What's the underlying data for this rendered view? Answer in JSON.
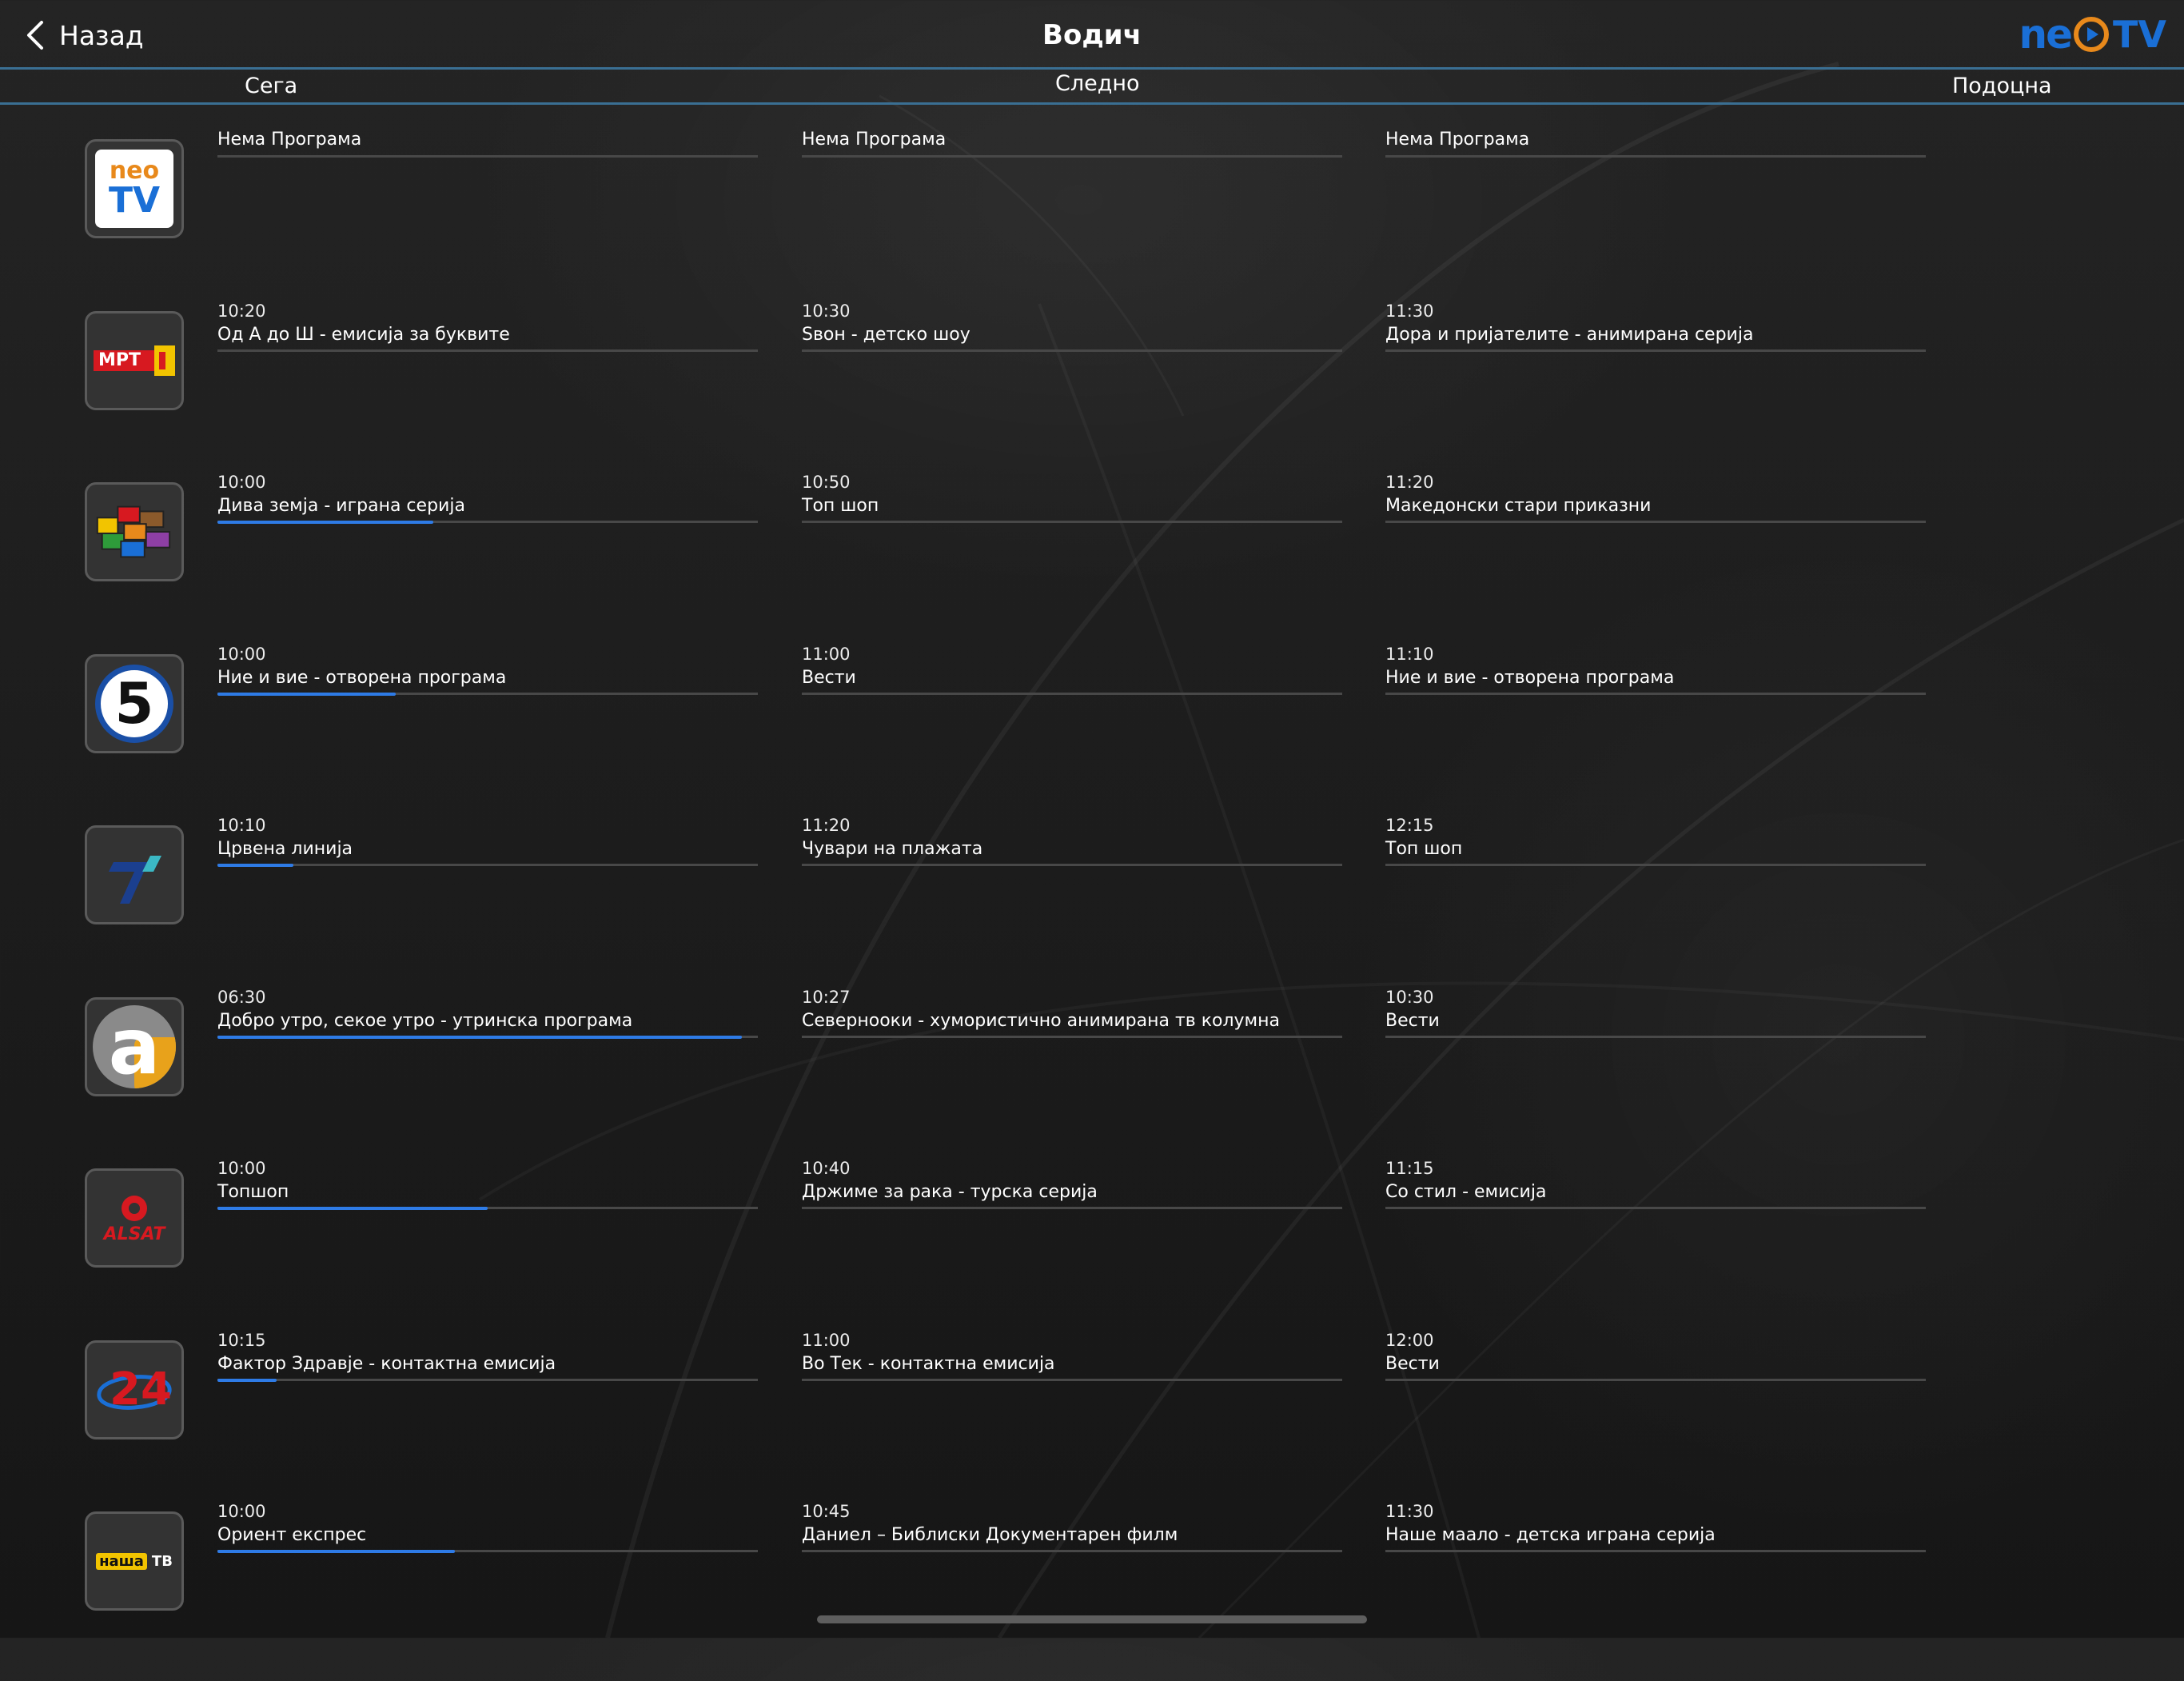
{
  "header": {
    "back_label": "Назад",
    "title": "Водич",
    "logo_neo": "ne",
    "logo_tv": "TV"
  },
  "columns": {
    "now": "Сега",
    "next": "Следно",
    "later": "Подоцна"
  },
  "channels": [
    {
      "logo": "neo-tv-logo",
      "logo_text_top": "neo",
      "logo_text_bottom": "TV",
      "now": {
        "time": "",
        "title": "Нема Програма",
        "progress": 0
      },
      "next": {
        "time": "",
        "title": "Нема Програма"
      },
      "later": {
        "time": "",
        "title": "Нема Програма"
      }
    },
    {
      "logo": "mrt1-logo",
      "logo_text": "МРТ",
      "now": {
        "time": "10:20",
        "title": "Од А до Ш - емисија за буквите",
        "progress": 0
      },
      "next": {
        "time": "10:30",
        "title": "Ѕвон - детско шоу"
      },
      "later": {
        "time": "11:30",
        "title": "Дора и пријателите - анимирана серија"
      }
    },
    {
      "logo": "colored-blocks-logo",
      "now": {
        "time": "10:00",
        "title": "Дива земја - играна серија",
        "progress": 0.4
      },
      "next": {
        "time": "10:50",
        "title": "Топ шоп"
      },
      "later": {
        "time": "11:20",
        "title": "Македонски стари приказни"
      }
    },
    {
      "logo": "kanal5-logo",
      "logo_text": "5",
      "now": {
        "time": "10:00",
        "title": "Ние и вие - отворена програма",
        "progress": 0.33
      },
      "next": {
        "time": "11:00",
        "title": "Вести"
      },
      "later": {
        "time": "11:10",
        "title": "Ние и вие - отворена програма"
      }
    },
    {
      "logo": "telma-logo",
      "now": {
        "time": "10:10",
        "title": "Црвена линија",
        "progress": 0.14
      },
      "next": {
        "time": "11:20",
        "title": "Чувари на плажата"
      },
      "later": {
        "time": "12:15",
        "title": "Топ шоп"
      }
    },
    {
      "logo": "alfa-logo",
      "logo_text": "a",
      "now": {
        "time": "06:30",
        "title": "Добро утро, секое утро - утринска програма",
        "progress": 0.97
      },
      "next": {
        "time": "10:27",
        "title": "Северноокиi - хумористично анимирана тв колумна"
      },
      "later": {
        "time": "10:30",
        "title": "Вести"
      }
    },
    {
      "logo": "alsat-m-logo",
      "logo_text": "ALSAT",
      "now": {
        "time": "10:00",
        "title": "Топшоп",
        "progress": 0.5
      },
      "next": {
        "time": "10:40",
        "title": "Држиме за рака - турска серија"
      },
      "later": {
        "time": "11:15",
        "title": "Со стил - емисија"
      }
    },
    {
      "logo": "tv24-logo",
      "logo_text": "24",
      "now": {
        "time": "10:15",
        "title": "Фактор Здравје - контактна емисија",
        "progress": 0.11
      },
      "next": {
        "time": "11:00",
        "title": "Во Тек - контактна емисија"
      },
      "later": {
        "time": "12:00",
        "title": "Вести"
      }
    },
    {
      "logo": "nasha-tv-logo",
      "logo_text": "наша",
      "logo_text_2": "ТВ",
      "now": {
        "time": "10:00",
        "title": "Ориент експрес",
        "progress": 0.44
      },
      "next": {
        "time": "10:45",
        "title": "Даниел – Библиски Документарен филм"
      },
      "later": {
        "time": "11:30",
        "title": "Наше маало - детска играна серија"
      }
    }
  ]
}
